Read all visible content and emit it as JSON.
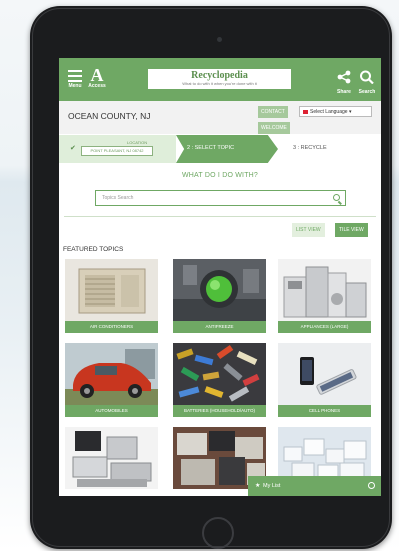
{
  "header": {
    "menu_label": "Menu",
    "access_letter": "A",
    "access_label": "Access",
    "logo_title": "Recyclopedia",
    "logo_tagline": "What to do with it when you're done with it",
    "share_label": "Share",
    "search_label": "Search"
  },
  "location": {
    "county": "OCEAN COUNTY, NJ",
    "contact_label": "CONTACT",
    "welcome_label": "WELCOME",
    "language_select": "Select Language"
  },
  "steps": {
    "step1_label": "LOCATION",
    "step1_value": "POINT PLEASANT, NJ 08742",
    "step2_label": "2 : SELECT TOPIC",
    "step3_label": "3 : RECYCLE"
  },
  "main": {
    "question": "WHAT DO I DO WITH?",
    "search_placeholder": "Topics Search",
    "list_view_label": "LIST VIEW",
    "tile_view_label": "TILE VIEW",
    "featured_heading": "FEATURED TOPICS"
  },
  "topics": [
    {
      "label": "AIR CONDITIONERS",
      "icon": "air-conditioner"
    },
    {
      "label": "ANTIFREEZE",
      "icon": "antifreeze"
    },
    {
      "label": "APPLIANCES (LARGE)",
      "icon": "appliances"
    },
    {
      "label": "AUTOMOBILES",
      "icon": "car"
    },
    {
      "label": "BATTERIES (HOUSEHOLD/AUTO)",
      "icon": "batteries"
    },
    {
      "label": "CELL PHONES",
      "icon": "cell-phone"
    }
  ],
  "footer": {
    "my_list_label": "My List"
  },
  "colors": {
    "brand_green": "#6fa864",
    "light_green": "#dfeeda"
  }
}
